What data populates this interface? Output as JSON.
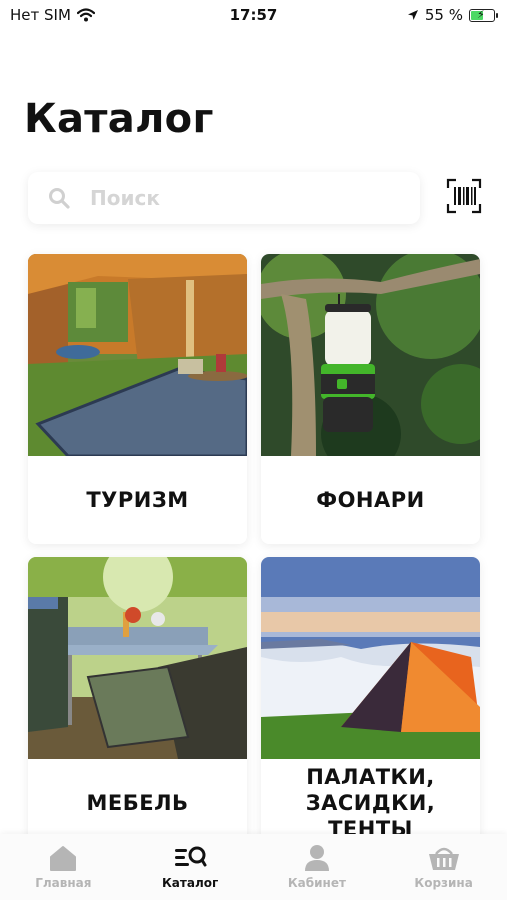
{
  "status_bar": {
    "carrier": "Нет SIM",
    "time": "17:57",
    "battery": "55 %",
    "battery_fraction": 0.55
  },
  "page": {
    "title": "Каталог"
  },
  "search": {
    "placeholder": "Поиск"
  },
  "categories": [
    {
      "label": "ТУРИЗМ"
    },
    {
      "label": "ФОНАРИ"
    },
    {
      "label": "МЕБЕЛЬ"
    },
    {
      "label": "ПАЛАТКИ,\nЗАСИДКИ, ТЕНТЫ"
    }
  ],
  "tabbar": {
    "items": [
      {
        "label": "Главная",
        "icon": "home-icon",
        "active": false
      },
      {
        "label": "Каталог",
        "icon": "catalog-search-icon",
        "active": true
      },
      {
        "label": "Кабинет",
        "icon": "user-icon",
        "active": false
      },
      {
        "label": "Корзина",
        "icon": "basket-icon",
        "active": false
      }
    ]
  },
  "colors": {
    "accent": "#111111",
    "inactive": "#b5b5b5",
    "placeholder": "#d5d5d5",
    "battery": "#4cd964"
  }
}
